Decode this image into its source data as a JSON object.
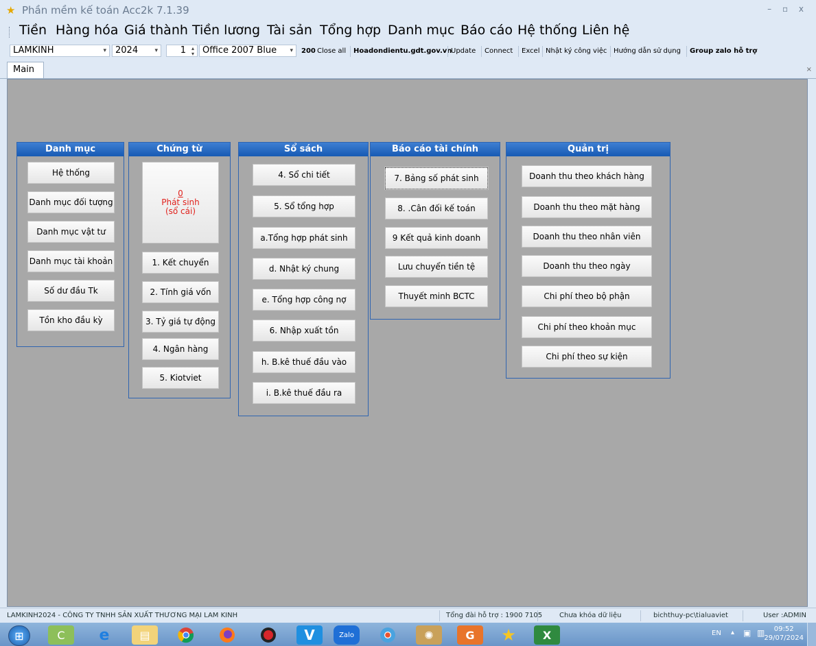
{
  "window": {
    "title": "Phần mềm kế toán Acc2k 7.1.39",
    "controls": "–  ▫  x"
  },
  "menu": [
    "Tiền",
    "Hàng hóa",
    "Giá thành",
    "Tiền lương",
    "Tài sản",
    "Tổng hợp",
    "Danh mục",
    "Báo cáo",
    "Hệ thống",
    "Liên hệ"
  ],
  "toolbar": {
    "company": "LAMKINH",
    "year": "2024",
    "period": "1",
    "theme": "Office 2007 Blue",
    "buttons": [
      "200",
      "Close all",
      "Hoadondientu.gdt.gov.vn",
      "Update",
      "Connect",
      "Excel",
      "Nhật ký công việc",
      "Hướng dẫn sử dụng",
      "Group zalo hỗ trợ"
    ]
  },
  "tabs": {
    "main": "Main",
    "close": "×"
  },
  "panels": {
    "danh_muc": {
      "title": "Danh mục",
      "buttons": [
        "Hệ thống",
        "Danh mục đối tượng",
        "Danh mục vật tư",
        "Danh mục tài khoản",
        "Số dư đầu Tk",
        "Tồn kho đầu kỳ"
      ]
    },
    "chung_tu": {
      "title": "Chứng từ",
      "big_count": "0",
      "big_line1": "Phát sinh",
      "big_line2": "(sổ cái)",
      "buttons": [
        "1. Kết chuyển",
        "2. Tính giá vốn",
        "3. Tỷ giá tự động",
        "4. Ngân hàng",
        "5. Kiotviet"
      ]
    },
    "so_sach": {
      "title": "Sổ sách",
      "buttons": [
        "4. Sổ chi tiết",
        "5. Sổ tổng hợp",
        "a.Tổng hợp phát sinh",
        "d. Nhật ký chung",
        "e. Tổng hợp công nợ",
        "6. Nhập xuất tồn",
        "h. B.kê thuế đầu vào",
        "i. B.kê thuế đầu ra"
      ]
    },
    "bao_cao": {
      "title": "Báo cáo tài chính",
      "buttons": [
        "7. Bảng số phát sinh",
        "8. .Cân đối kế toán",
        "9 Kết quả kinh doanh",
        "Lưu chuyển tiền tệ",
        "Thuyết minh BCTC"
      ]
    },
    "quan_tri": {
      "title": "Quản trị",
      "buttons": [
        "Doanh thu theo khách hàng",
        "Doanh thu theo mặt hàng",
        "Doanh thu theo nhân viên",
        "Doanh thu theo ngày",
        "Chi phí theo bộ phận",
        "Chi phí theo khoản mục",
        "Chi phí theo sự kiện"
      ]
    }
  },
  "status": {
    "company": "LAMKINH2024 - CÔNG TY TNHH SẢN XUẤT THƯƠNG MẠI LAM KINH",
    "hotline": "Tổng đài hỗ trợ : 1900 7105",
    "lock": "Chưa khóa dữ liệu",
    "machine": "bichthuy-pc\\tialuaviet",
    "user": "User :ADMIN"
  },
  "taskbar": {
    "apps": [
      "start-orb",
      "cc-cleaner",
      "internet-explorer",
      "file-explorer",
      "chrome",
      "firefox",
      "app-red",
      "app-v",
      "zalo",
      "chrome-2",
      "vietbao",
      "coc-coc",
      "acc2k",
      "excel"
    ],
    "zalo_label": "Zalo",
    "lang": "EN",
    "time": "09:52",
    "date": "29/07/2024"
  },
  "colors": {
    "accent": "#175ab4",
    "workspace": "#a8a8a8",
    "highlight_red": "#e0211c"
  }
}
